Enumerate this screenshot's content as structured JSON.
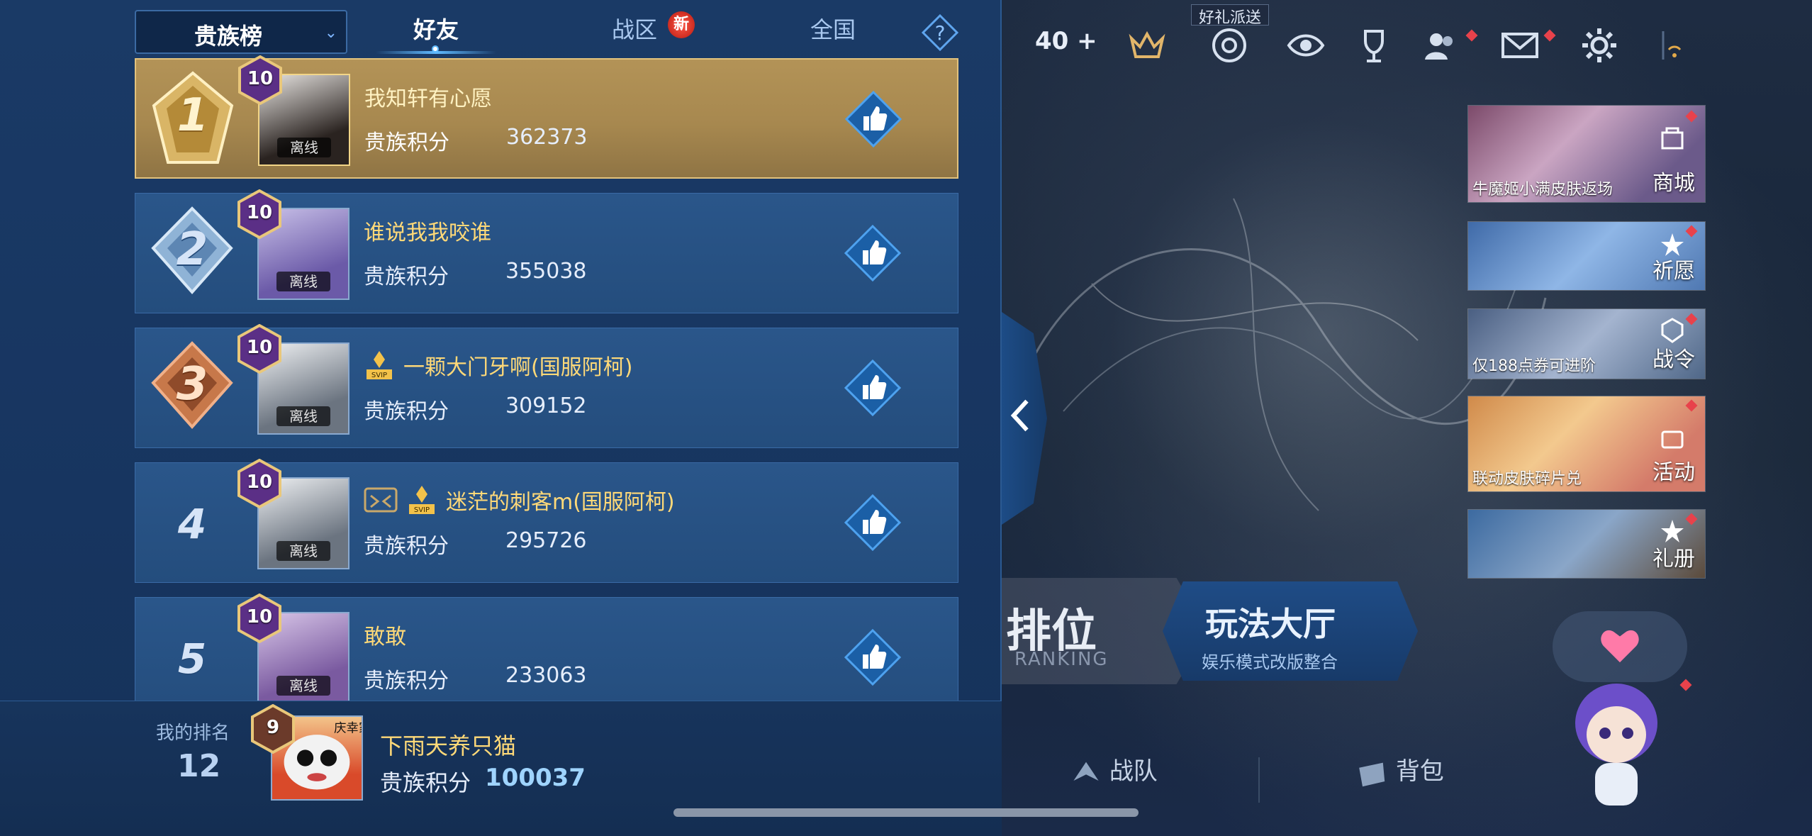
{
  "tabs": {
    "dropdown_label": "贵族榜",
    "friends": "好友",
    "zone": "战区",
    "zone_badge": "新",
    "national": "全国"
  },
  "rows": [
    {
      "rank": "1",
      "tier": "10",
      "name": "我知轩有心愿",
      "score_label": "贵族积分",
      "score": "362373",
      "status": "离线"
    },
    {
      "rank": "2",
      "tier": "10",
      "name": "谁说我我咬谁",
      "score_label": "贵族积分",
      "score": "355038",
      "status": "离线"
    },
    {
      "rank": "3",
      "tier": "10",
      "name": "一颗大门牙啊(国服阿柯)",
      "score_label": "贵族积分",
      "score": "309152",
      "status": "离线",
      "badge": "SVIP"
    },
    {
      "rank": "4",
      "tier": "10",
      "name": "迷茫的刺客m(国服阿柯)",
      "score_label": "贵族积分",
      "score": "295726",
      "status": "离线",
      "badge": "SVIP"
    },
    {
      "rank": "5",
      "tier": "10",
      "name": "敢敢",
      "score_label": "贵族积分",
      "score": "233063",
      "status": "离线"
    }
  ],
  "my_rank": {
    "label": "我的排名",
    "rank": "12",
    "tier": "9",
    "name": "下雨天养只猫",
    "score_label": "贵族积分",
    "score": "100037",
    "avatar_text": "庆幸家"
  },
  "hud": {
    "friends_count": "40",
    "gift_tag": "好礼派送"
  },
  "side_cards": [
    {
      "caption": "牛魔姬小满皮肤返场",
      "action": "商城"
    },
    {
      "caption": "",
      "action": "祈愿"
    },
    {
      "caption": "仅188点券可进阶",
      "action": "战令"
    },
    {
      "caption": "联动皮肤碎片兑",
      "action": "活动"
    },
    {
      "caption": "",
      "action": "礼册"
    }
  ],
  "modes": {
    "ranked": "排位",
    "ranked_sub": "RANKING",
    "lobby": "玩法大厅",
    "lobby_sub": "娱乐模式改版整合"
  },
  "bottom_nav": {
    "team": "战队",
    "bag": "背包"
  },
  "colors": {
    "first_row": "#b39357",
    "row": "#2a568a",
    "name": "#ffd978",
    "accent": "#5fbaff"
  }
}
